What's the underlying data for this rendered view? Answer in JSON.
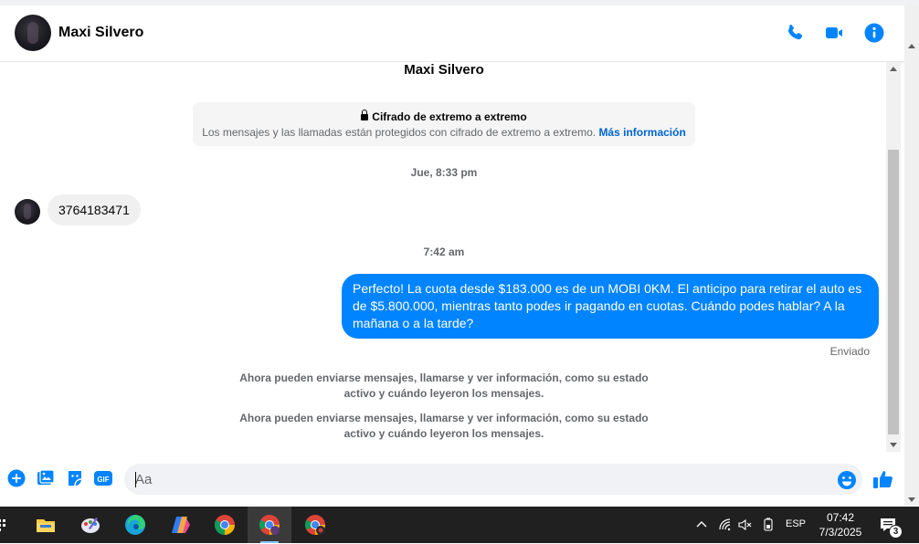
{
  "header": {
    "contact_name": "Maxi Silvero",
    "icons": [
      "phone-icon",
      "video-icon",
      "info-icon"
    ],
    "accent_color": "#0084ff"
  },
  "chat": {
    "contact_title": "Maxi Silvero",
    "encryption": {
      "title": "Cifrado de extremo a extremo",
      "description": "Los mensajes y las llamadas están protegidos con cifrado de extremo a extremo.",
      "link": "Más información"
    },
    "timestamp_1": "Jue, 8:33 pm",
    "incoming_message": "3764183471",
    "timestamp_2": "7:42 am",
    "outgoing_message": "Perfecto! La cuota desde $183.000 es de un MOBI 0KM. El anticipo para retirar el auto es de $5.800.000, mientras tanto podes ir pagando en cuotas. Cuándo podes hablar? A la mañana o a la tarde?",
    "sent_status": "Enviado",
    "system_messages": [
      {
        "line1": "Ahora pueden enviarse mensajes, llamarse y ver información, como su estado",
        "line2": "activo y cuándo leyeron los mensajes."
      },
      {
        "line1": "Ahora pueden enviarse mensajes, llamarse y ver información, como su estado",
        "line2": "activo y cuándo leyeron los mensajes."
      }
    ]
  },
  "composer": {
    "placeholder": "Aa",
    "icons": [
      "plus-icon",
      "photo-icon",
      "sticker-icon",
      "gif-icon",
      "emoji-icon",
      "like-icon"
    ],
    "gif_label": "GIF"
  },
  "taskbar": {
    "apps": [
      "file-explorer-icon",
      "paint-icon",
      "edge-icon",
      "copilot-icon",
      "chrome-icon",
      "chrome-profile-icon",
      "chrome-profile-2-icon"
    ],
    "language": "ESP",
    "time": "07:42",
    "date": "7/3/2025",
    "notification_count": "3"
  }
}
